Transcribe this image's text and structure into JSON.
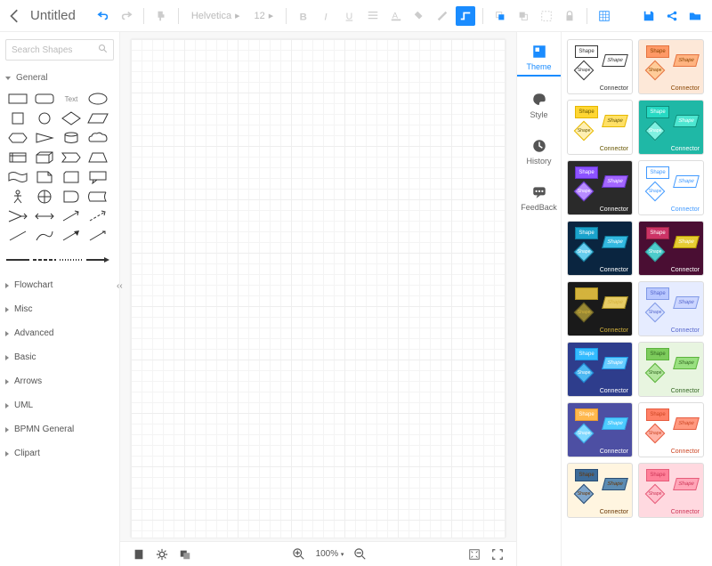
{
  "header": {
    "title": "Untitled",
    "font_family": "Helvetica",
    "font_size": "12"
  },
  "sidebar": {
    "search_placeholder": "Search Shapes",
    "general_label": "General",
    "text_label": "Text",
    "categories": [
      "Flowchart",
      "Misc",
      "Advanced",
      "Basic",
      "Arrows",
      "UML",
      "BPMN General",
      "Clipart"
    ]
  },
  "canvas": {
    "zoom": "100%"
  },
  "right_panel": {
    "items": [
      "Theme",
      "Style",
      "History",
      "FeedBack"
    ]
  },
  "theme": {
    "shape_label": "Shape",
    "connector_label": "Connector",
    "themes": [
      {
        "bg": "#ffffff",
        "s1": "#ffffff",
        "s1b": "#333",
        "s2": "#ffffff",
        "s2b": "#333",
        "d": "#ffffff",
        "db": "#333",
        "txt": "#333"
      },
      {
        "bg": "#fde8d8",
        "s1": "#ff9966",
        "s1b": "#e57340",
        "s2": "#ffb380",
        "s2b": "#e57340",
        "d": "#ffcc99",
        "db": "#e57340",
        "txt": "#884400"
      },
      {
        "bg": "#ffffff",
        "s1": "#ffd633",
        "s1b": "#e6b800",
        "s2": "#ffe066",
        "s2b": "#e6b800",
        "d": "#fff0b3",
        "db": "#e6b800",
        "txt": "#665500"
      },
      {
        "bg": "#1fb8a6",
        "s1": "#26d9c3",
        "s1b": "#0e8c7a",
        "s2": "#4de6d1",
        "s2b": "#0e8c7a",
        "d": "#80f0e0",
        "db": "#0e8c7a",
        "txt": "#ffffff"
      },
      {
        "bg": "#2a2a2a",
        "s1": "#8c52ff",
        "s1b": "#6633cc",
        "s2": "#a366ff",
        "s2b": "#6633cc",
        "d": "#b88cff",
        "db": "#6633cc",
        "txt": "#ffffff"
      },
      {
        "bg": "#ffffff",
        "s1": "#ffffff",
        "s1b": "#4099ff",
        "s2": "#ffffff",
        "s2b": "#4099ff",
        "d": "#ffffff",
        "db": "#4099ff",
        "txt": "#4099ff"
      },
      {
        "bg": "#0a2540",
        "s1": "#1aa3cc",
        "s1b": "#0e7a99",
        "s2": "#33b8e0",
        "s2b": "#0e7a99",
        "d": "#66ccee",
        "db": "#0e7a99",
        "txt": "#ffffff"
      },
      {
        "bg": "#4a0e33",
        "s1": "#cc3366",
        "s1b": "#992244",
        "s2": "#e6cc33",
        "s2b": "#b39900",
        "d": "#4dcccc",
        "db": "#2e9999",
        "txt": "#ffffff"
      },
      {
        "bg": "#1a1a1a",
        "s1": "#d4b33d",
        "s1b": "#a68c1f",
        "s2": "#e6cc66",
        "s2b": "#a68c1f",
        "d": "#998833",
        "db": "#665c22",
        "txt": "#d4b33d"
      },
      {
        "bg": "#e6ecff",
        "s1": "#b8c7ff",
        "s1b": "#8099e6",
        "s2": "#ccd6ff",
        "s2b": "#8099e6",
        "d": "#d6e0ff",
        "db": "#8099e6",
        "txt": "#5566cc"
      },
      {
        "bg": "#2e3d8c",
        "s1": "#33bbff",
        "s1b": "#1a99e6",
        "s2": "#66ccff",
        "s2b": "#1a99e6",
        "d": "#4db8f2",
        "db": "#1a80cc",
        "txt": "#ffffff"
      },
      {
        "bg": "#e8f5e0",
        "s1": "#7dcc5c",
        "s1b": "#5cb33d",
        "s2": "#99e080",
        "s2b": "#5cb33d",
        "d": "#b3e69e",
        "db": "#5cb33d",
        "txt": "#336622"
      },
      {
        "bg": "#4d4fa3",
        "s1": "#ffb84d",
        "s1b": "#e69933",
        "s2": "#4dccff",
        "s2b": "#33a6e6",
        "d": "#80d9ff",
        "db": "#33a6e6",
        "txt": "#ffffff"
      },
      {
        "bg": "#ffffff",
        "s1": "#ff8066",
        "s1b": "#e65c40",
        "s2": "#ff9980",
        "s2b": "#e65c40",
        "d": "#ffb3a6",
        "db": "#e65c40",
        "txt": "#cc4422"
      },
      {
        "bg": "#fff5e0",
        "s1": "#3d6b99",
        "s1b": "#2a4d73",
        "s2": "#5c8cb3",
        "s2b": "#2a4d73",
        "d": "#80a6cc",
        "db": "#2a4d73",
        "txt": "#663300"
      },
      {
        "bg": "#ffd9e0",
        "s1": "#ff8099",
        "s1b": "#e65c7a",
        "s2": "#ffa6b8",
        "s2b": "#e65c7a",
        "d": "#ffbfcc",
        "db": "#e65c7a",
        "txt": "#cc3355"
      }
    ]
  }
}
